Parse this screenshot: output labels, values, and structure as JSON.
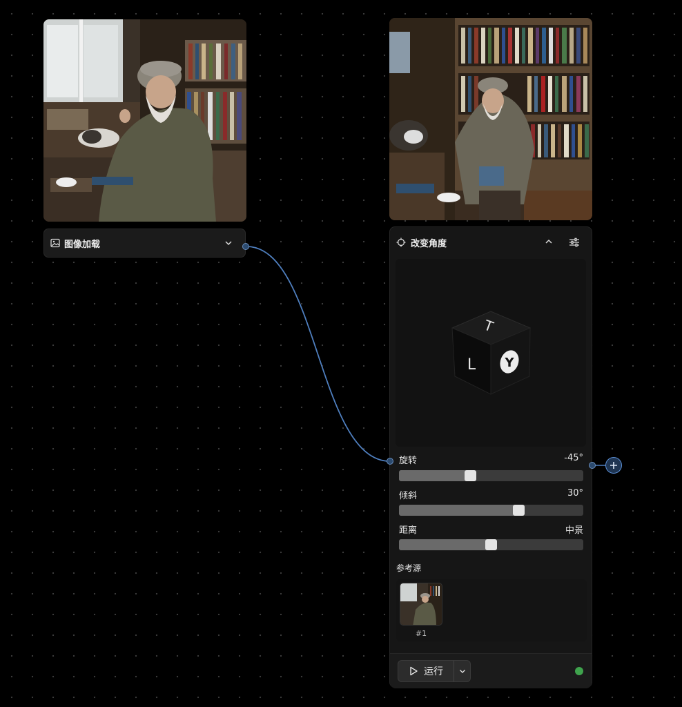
{
  "load_node": {
    "title": "图像加载"
  },
  "angle_node": {
    "title": "改变角度",
    "cube_faces": [
      "T",
      "L",
      "Y"
    ],
    "sliders": [
      {
        "label": "旋转",
        "value_text": "-45°",
        "level": 0.38
      },
      {
        "label": "倾斜",
        "value_text": "30°",
        "level": 0.66
      },
      {
        "label": "距离",
        "value_text": "中景",
        "level": 0.5
      }
    ],
    "reference": {
      "label": "参考源",
      "items": [
        {
          "caption": "#1"
        }
      ]
    },
    "run_label": "运行",
    "status_color": "#3fa34d"
  },
  "colors": {
    "accent": "#5b8fd6",
    "canvas": "#000000",
    "panel": "#161616"
  },
  "icons": [
    "image-icon",
    "chevron-down-icon",
    "crosshair-icon",
    "chevron-up-icon",
    "sliders-icon",
    "plus-icon",
    "play-icon"
  ]
}
